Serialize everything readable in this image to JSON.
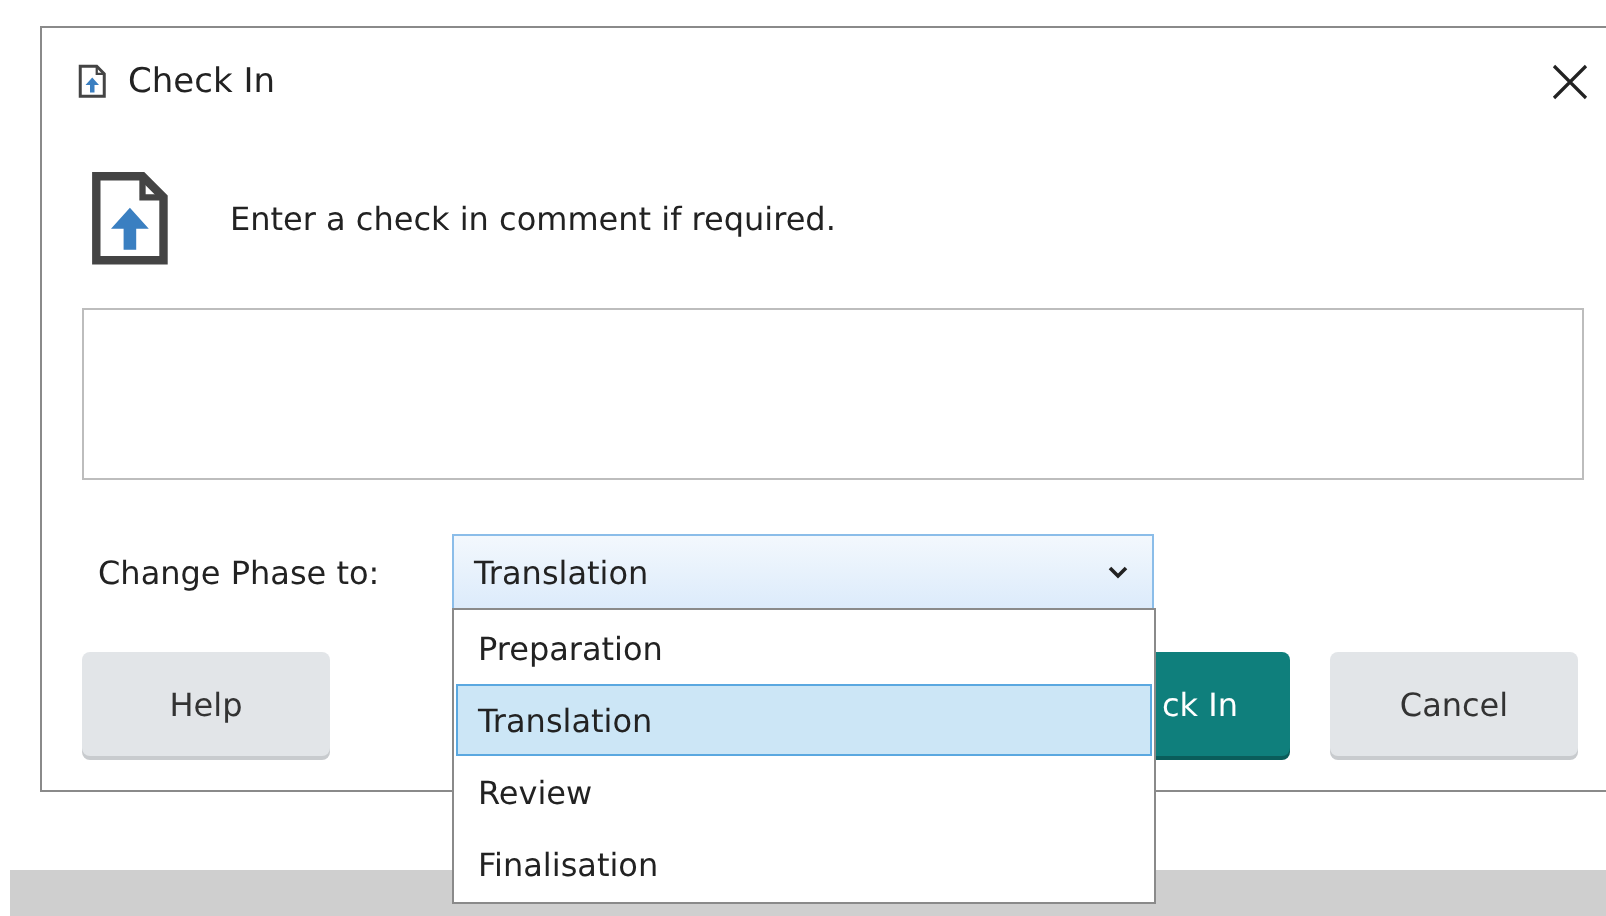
{
  "window": {
    "title": "Check In"
  },
  "message": "Enter a check in comment if required.",
  "phase": {
    "label": "Change Phase to:",
    "value": "Translation",
    "expanded": true,
    "options": [
      {
        "label": "Preparation",
        "selected": false
      },
      {
        "label": "Translation",
        "selected": true
      },
      {
        "label": "Review",
        "selected": false
      },
      {
        "label": "Finalisation",
        "selected": false
      }
    ]
  },
  "buttons": [
    {
      "label": "Help",
      "kind": "default"
    },
    {
      "label": "ck In",
      "kind": "primary"
    },
    {
      "label": "Cancel",
      "kind": "default"
    }
  ]
}
